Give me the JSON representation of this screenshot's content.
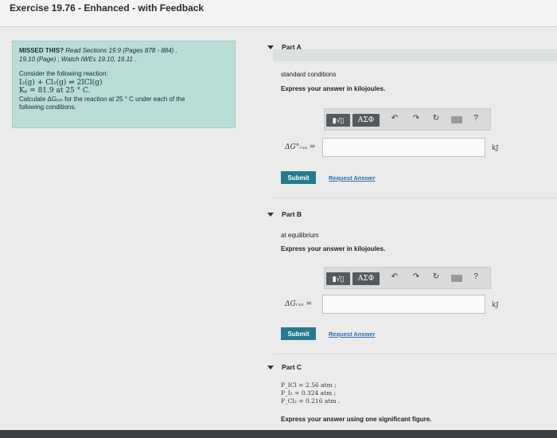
{
  "window": {
    "title": "Exercise 19.76 - Enhanced - with Feedback"
  },
  "hint": {
    "missed": "MISSED THIS?",
    "read": "Read Sections 19.9 (Pages 878 - 884) ,",
    "watch": "19.10 (Page) ; Watch IWEs 19.10, 19.11 .",
    "intro": "Consider the following reaction:",
    "reaction": "I₂(g) + Cl₂(g) ⇌ 2ICl(g)",
    "kp": "Kₚ = 81.9 at 25 ° C.",
    "question_line1": "Calculate ΔGᵣₓₙ for the reaction at 25 ° C under each of the",
    "question_line2": "following conditions."
  },
  "toolbar": {
    "sqrt_label": "▮√▯",
    "greek_label": "ΑΣΦ",
    "undo_icon": "↶",
    "redo_icon": "↷",
    "reset_icon": "↻",
    "keyboard_icon": "keyboard-icon",
    "help_label": "?"
  },
  "part_a": {
    "header": "Part A",
    "condition": "standard conditions",
    "instruction": "Express your answer in kilojoules.",
    "answer_label": "ΔG°ᵣₓₙ =",
    "answer_value": "",
    "unit": "kJ",
    "submit_label": "Submit",
    "request_label": "Request Answer"
  },
  "part_b": {
    "header": "Part B",
    "condition": "at equilibrium",
    "instruction": "Express your answer in kilojoules.",
    "answer_label": "ΔGᵣₓₙ =",
    "answer_value": "",
    "unit": "kJ",
    "submit_label": "Submit",
    "request_label": "Request Answer"
  },
  "part_c": {
    "header": "Part C",
    "p_icl": "P_ICl = 2.56 atm ;",
    "p_i2": "P_I₂ = 0.324 atm ;",
    "p_cl2": "P_Cl₂ = 0.216 atm .",
    "instruction": "Express your answer using one significant figure."
  }
}
